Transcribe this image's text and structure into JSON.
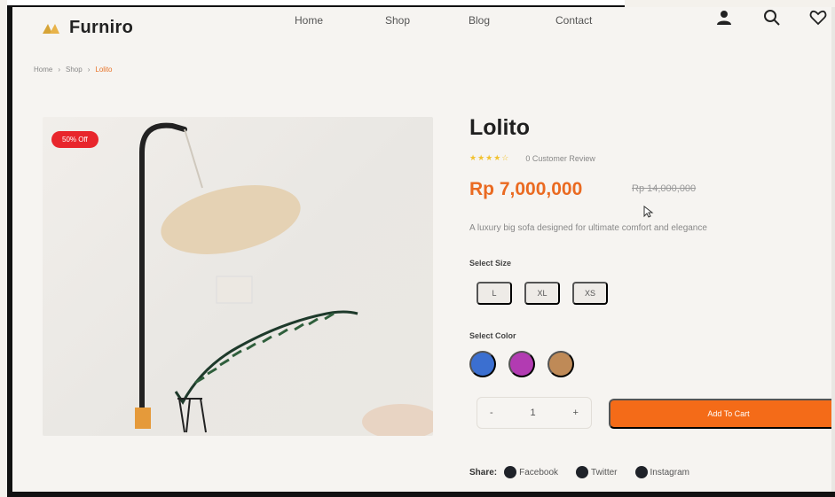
{
  "brand": {
    "name": "Furniro",
    "accent": "#e8742a"
  },
  "nav": {
    "home": "Home",
    "shop": "Shop",
    "blog": "Blog",
    "contact": "Contact"
  },
  "header_icons": [
    "user-icon",
    "search-icon",
    "heart-icon"
  ],
  "breadcrumb": {
    "items": [
      "Home",
      "Shop"
    ],
    "current": "Lolito"
  },
  "product": {
    "badge": "50% Off",
    "title": "Lolito",
    "rating_stars": "★★★★☆",
    "rating_value": 4,
    "reviews": "0 Customer Review",
    "price": "Rp 7,000,000",
    "old_price": "Rp 14,000,000",
    "description": "A luxury big sofa designed for ultimate comfort and elegance"
  },
  "size": {
    "label": "Select Size",
    "options": [
      "L",
      "XL",
      "XS"
    ]
  },
  "color": {
    "label": "Select Color",
    "options": [
      "#3b6fd0",
      "#b23bb2",
      "#bf8a57"
    ]
  },
  "quantity": {
    "minus": "-",
    "value": "1",
    "plus": "+"
  },
  "cart": {
    "label": "Add To Cart",
    "color": "#f46b18"
  },
  "share": {
    "label": "Share:",
    "items": [
      "Facebook",
      "Twitter",
      "Instagram"
    ]
  }
}
